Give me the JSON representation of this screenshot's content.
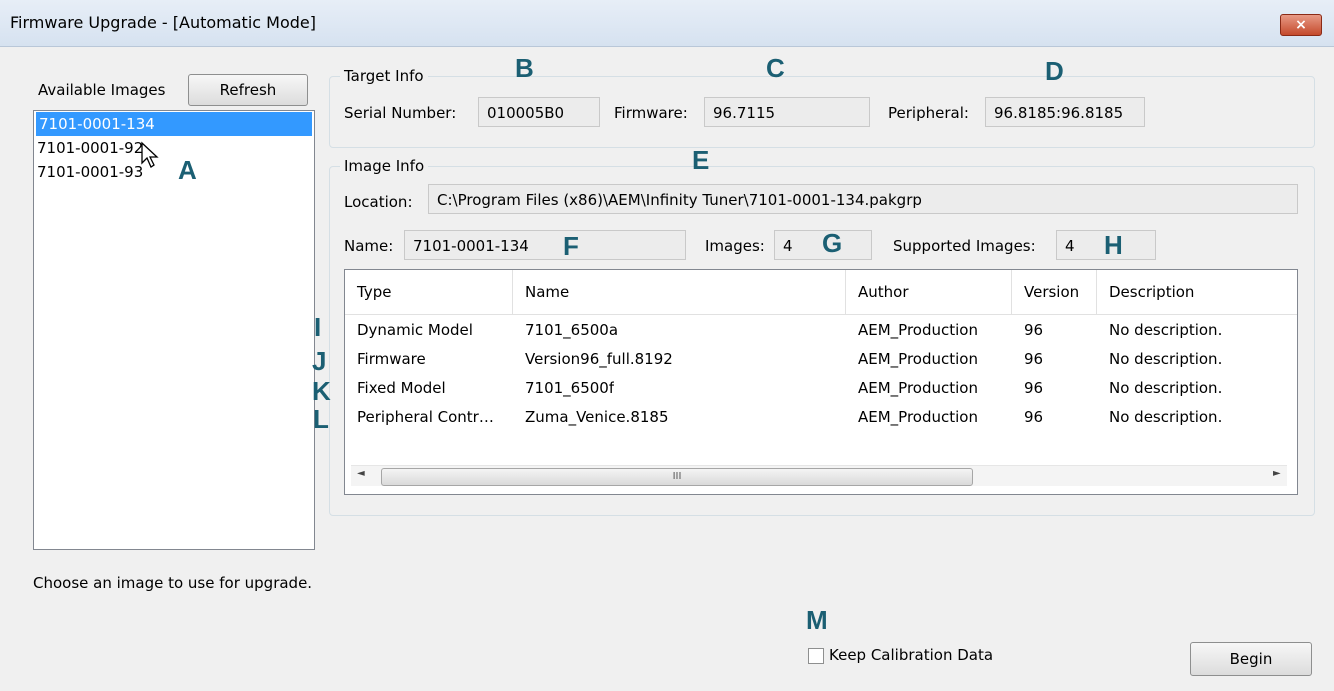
{
  "window": {
    "title": "Firmware Upgrade - [Automatic Mode]",
    "close_label": "×"
  },
  "left": {
    "available_label": "Available Images",
    "refresh_label": "Refresh",
    "images": [
      "7101-0001-134",
      "7101-0001-92",
      "7101-0001-93"
    ],
    "selected_index": 0,
    "hint": "Choose an image to use for upgrade."
  },
  "target_info": {
    "label": "Target Info",
    "serial_label": "Serial Number:",
    "serial_value": "010005B0",
    "firmware_label": "Firmware:",
    "firmware_value": "96.7115",
    "peripheral_label": "Peripheral:",
    "peripheral_value": "96.8185:96.8185"
  },
  "image_info": {
    "label": "Image Info",
    "location_label": "Location:",
    "location_value": "C:\\Program Files (x86)\\AEM\\Infinity Tuner\\7101-0001-134.pakgrp",
    "name_label": "Name:",
    "name_value": "7101-0001-134",
    "images_label": "Images:",
    "images_value": "4",
    "supported_label": "Supported Images:",
    "supported_value": "4"
  },
  "table": {
    "columns": [
      "Type",
      "Name",
      "Author",
      "Version",
      "Description"
    ],
    "rows": [
      [
        "Dynamic Model",
        "7101_6500a",
        "AEM_Production",
        "96",
        "No description."
      ],
      [
        "Firmware",
        "Version96_full.8192",
        "AEM_Production",
        "96",
        "No description."
      ],
      [
        "Fixed Model",
        "7101_6500f",
        "AEM_Production",
        "96",
        "No description."
      ],
      [
        "Peripheral Contr…",
        "Zuma_Venice.8185",
        "AEM_Production",
        "96",
        "No description."
      ]
    ],
    "scroll_thumb_grip": "III",
    "scroll_left": "◄",
    "scroll_right": "►"
  },
  "footer": {
    "keep_calibration_label": "Keep Calibration Data",
    "keep_calibration_checked": false,
    "begin_label": "Begin"
  },
  "annotations": {
    "A": "A",
    "B": "B",
    "C": "C",
    "D": "D",
    "E": "E",
    "F": "F",
    "G": "G",
    "H": "H",
    "I": "I",
    "J": "J",
    "K": "K",
    "L": "L",
    "M": "M"
  }
}
